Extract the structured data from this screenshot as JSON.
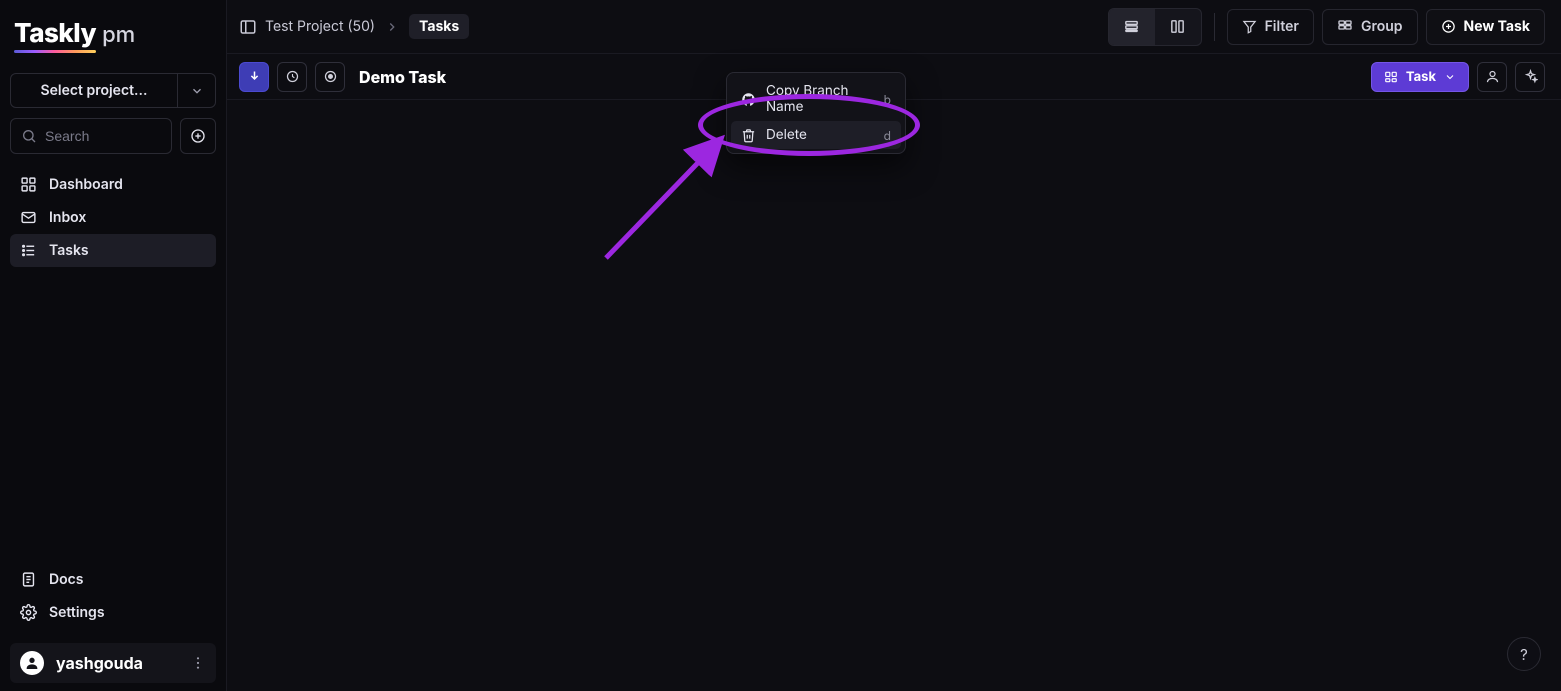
{
  "logo": {
    "main": "Taskly",
    "sub": "pm"
  },
  "sidebar": {
    "project_select_label": "Select project...",
    "search_placeholder": "Search",
    "nav": [
      {
        "label": "Dashboard"
      },
      {
        "label": "Inbox"
      },
      {
        "label": "Tasks"
      }
    ],
    "bottom_nav": [
      {
        "label": "Docs"
      },
      {
        "label": "Settings"
      }
    ],
    "user": {
      "name": "yashgouda"
    }
  },
  "topbar": {
    "breadcrumb": {
      "project": "Test Project (50)",
      "current": "Tasks"
    },
    "filter_label": "Filter",
    "group_label": "Group",
    "new_task_label": "New Task"
  },
  "task": {
    "title": "Demo Task",
    "type_button_label": "Task"
  },
  "context_menu": {
    "items": [
      {
        "label": "Copy Branch Name",
        "shortcut": "b"
      },
      {
        "label": "Delete",
        "shortcut": "d"
      }
    ]
  },
  "help_label": "?"
}
